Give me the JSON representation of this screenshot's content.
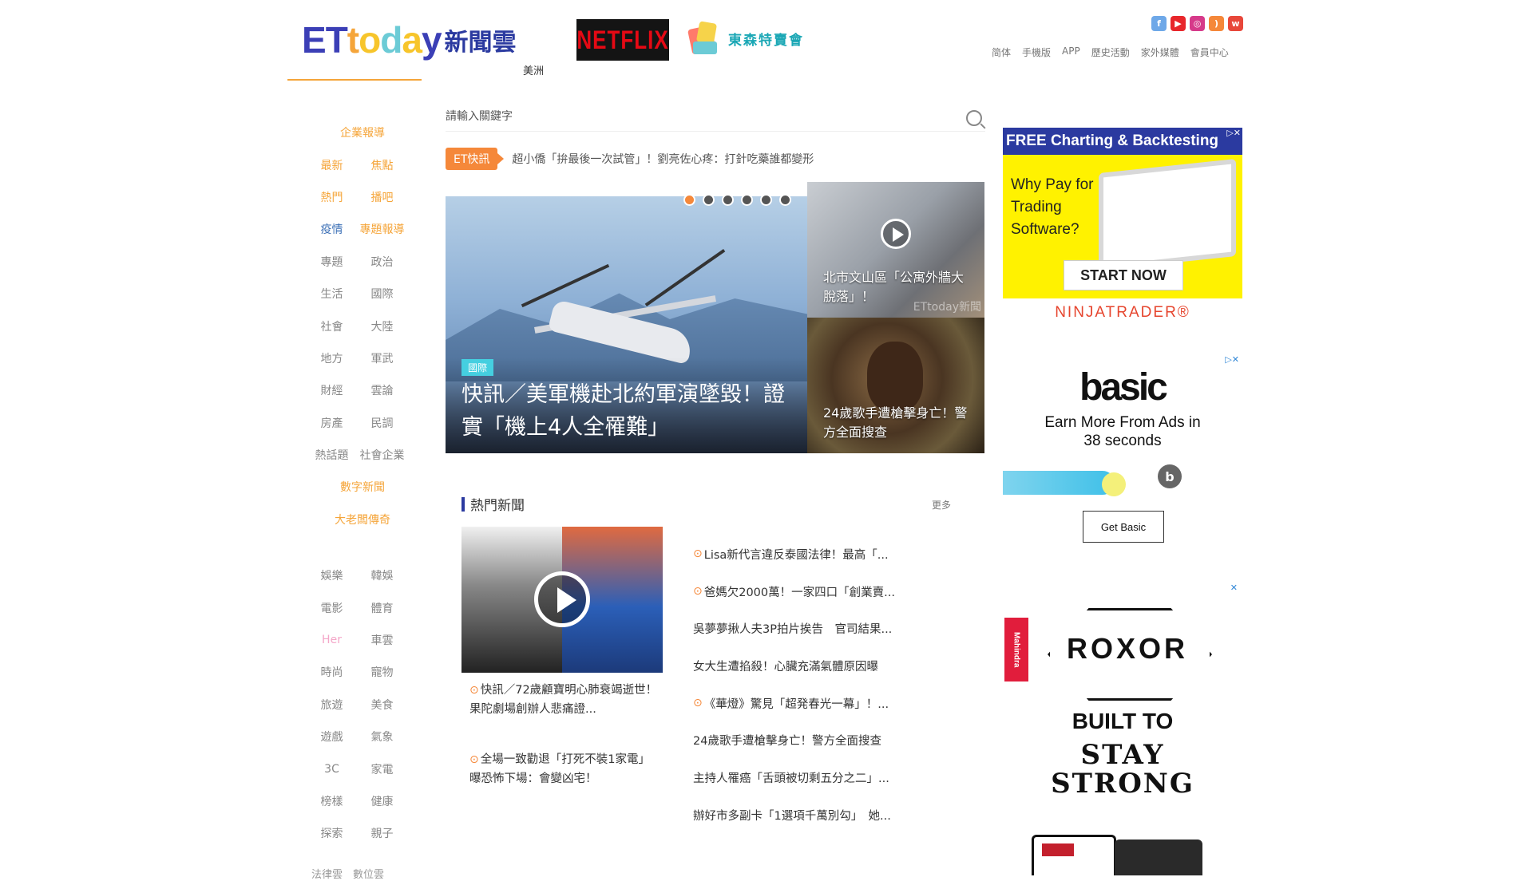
{
  "header": {
    "logo_et": "ETtoday",
    "logo_cn": "新聞雲",
    "region": "美洲",
    "netflix": "NETFLIX",
    "promo": "東森特賣會",
    "social_icons": [
      "facebook-icon",
      "youtube-icon",
      "instagram-icon",
      "rss-icon",
      "weibo-icon"
    ],
    "top_nav": [
      "简体",
      "手機版",
      "APP",
      "歷史活動",
      "家外媒體",
      "會員中心"
    ]
  },
  "sidebar": {
    "rows": [
      {
        "single": "企業報導"
      },
      {
        "c1": "最新",
        "c2": "焦點"
      },
      {
        "c1": "熱門",
        "c2": "播吧"
      },
      {
        "c1": "疫情",
        "c2": "專題報導"
      },
      {
        "c1": "專題",
        "c2": "政治"
      },
      {
        "c1": "生活",
        "c2": "國際"
      },
      {
        "c1": "社會",
        "c2": "大陸"
      },
      {
        "c1": "地方",
        "c2": "軍武"
      },
      {
        "c1": "財經",
        "c2": "雲論"
      },
      {
        "c1": "房產",
        "c2": "民調"
      },
      {
        "c1": "熱話題",
        "c2": "社會企業"
      },
      {
        "single": "數字新聞"
      },
      {
        "single": "大老闆傳奇"
      }
    ],
    "rows2": [
      {
        "c1": "娛樂",
        "c2": "韓娛"
      },
      {
        "c1": "電影",
        "c2": "體育"
      },
      {
        "c1": "Her",
        "c2": "車雲"
      },
      {
        "c1": "時尚",
        "c2": "寵物"
      },
      {
        "c1": "旅遊",
        "c2": "美食"
      },
      {
        "c1": "遊戲",
        "c2": "氣象"
      },
      {
        "c1": "3C",
        "c2": "家電"
      },
      {
        "c1": "榜樣",
        "c2": "健康"
      },
      {
        "c1": "探索",
        "c2": "親子"
      }
    ],
    "bottom": "法律雲　數位雲"
  },
  "search": {
    "placeholder": "請輸入關鍵字"
  },
  "ticker": {
    "badge": "ET快訊",
    "text": "超小僑「拚最後一次試管」！劉亮佐心疼：打針吃藥誰都變形"
  },
  "slider": {
    "category": "國際",
    "title": "快訊／美軍機赴北約軍演墜毀！證實「機上4人全罹難」",
    "side1_title": "北市文山區「公寓外牆大脫落」！",
    "side2_title": "24歲歌手遭槍擊身亡！警方全面搜查",
    "watermark": "ETtoday新聞"
  },
  "hot": {
    "title": "熱門新聞",
    "more": "更多",
    "left_items": [
      "快訊／72歲顧寶明心肺衰竭逝世！果陀劇場創辦人悲痛證...",
      "全場一致勸退「打死不裝1家電」　曝恐怖下場：會變凶宅！"
    ],
    "list": [
      {
        "text": "Lisa新代言違反泰國法律！最高「...",
        "video": true
      },
      {
        "text": "爸媽欠2000萬！一家四口「創業賣...",
        "video": true
      },
      {
        "text": "吳夢夢揪人夫3P拍片挨告　官司結果...",
        "video": false
      },
      {
        "text": "女大生遭掐殺！心臟充滿氣體原因曝",
        "video": false
      },
      {
        "text": "《華燈》驚見「超発春光一幕」！...",
        "video": true
      },
      {
        "text": "24歲歌手遭槍擊身亡！警方全面搜查",
        "video": false
      },
      {
        "text": "主持人罹癌「舌頭被切剩五分之二」...",
        "video": false
      },
      {
        "text": "辦好市多副卡「1選項千萬別勾」　她...",
        "video": false
      }
    ]
  },
  "ads": {
    "ad1": {
      "header": "FREE Charting & Backtesting",
      "why": "Why Pay for Trading Software?",
      "button": "START NOW",
      "footer": "NINJATRADER®"
    },
    "ad2": {
      "brand": "basic",
      "tagline": "Earn More From Ads in 38 seconds",
      "b": "b",
      "button": "Get Basic"
    },
    "ad3": {
      "mahindra": "Mahindra",
      "roxor": "ROXOR",
      "built": "BUILT TO",
      "stay": "STAY STRONG"
    }
  }
}
